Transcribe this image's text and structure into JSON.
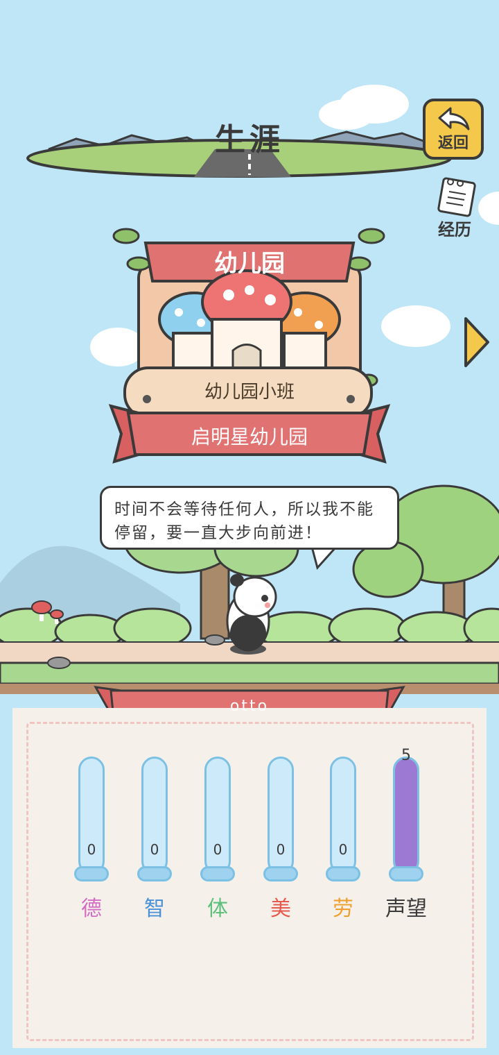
{
  "header": {
    "title": "生涯"
  },
  "buttons": {
    "back_label": "返回",
    "resume_label": "经历"
  },
  "stage": {
    "school_type": "幼儿园",
    "class_name": "幼儿园小班",
    "school_name": "启明星幼儿园"
  },
  "speech": "时间不会等待任何人，所以我不能停留，要一直大步向前进！",
  "player": {
    "name": "otto"
  },
  "stats": [
    {
      "label": "德",
      "value": "0",
      "color": "#d46cc4",
      "level": 0
    },
    {
      "label": "智",
      "value": "0",
      "color": "#4a90d9",
      "level": 0
    },
    {
      "label": "体",
      "value": "0",
      "color": "#5cc07a",
      "level": 0
    },
    {
      "label": "美",
      "value": "0",
      "color": "#e65a4e",
      "level": 0
    },
    {
      "label": "劳",
      "value": "0",
      "color": "#f0a030",
      "level": 0
    },
    {
      "label": "声望",
      "value": "5",
      "color": "#3a3a3a",
      "level": 1.0,
      "fill_color": "#9c7ad4"
    }
  ]
}
